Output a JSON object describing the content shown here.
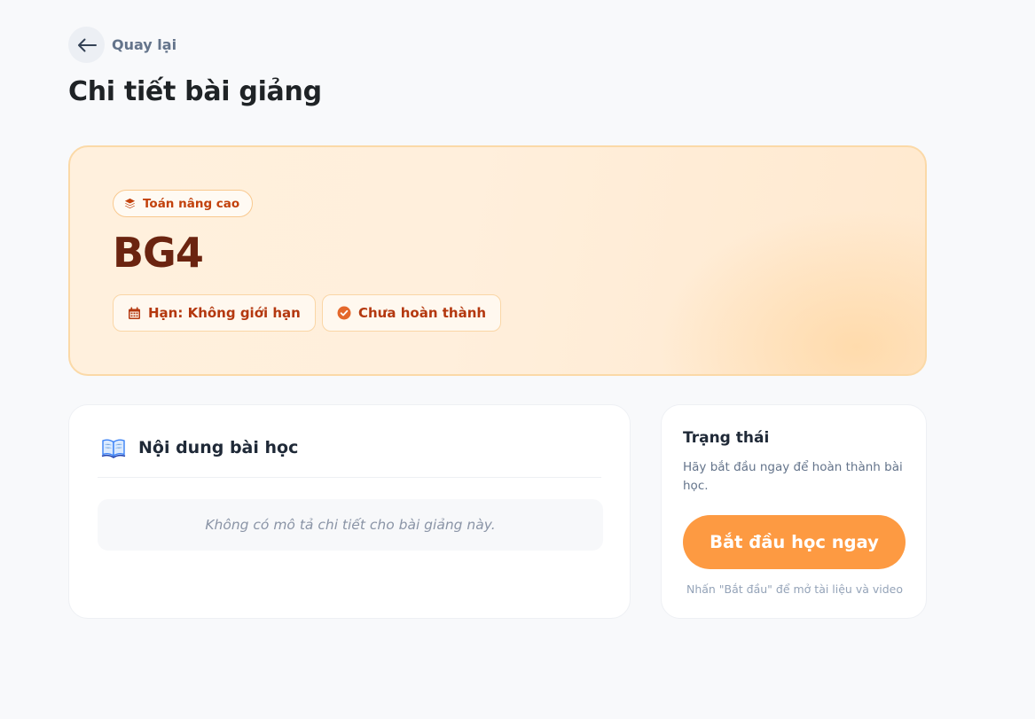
{
  "nav": {
    "back_label": "Quay lại"
  },
  "page": {
    "title": "Chi tiết bài giảng"
  },
  "lecture": {
    "category": "Toán nâng cao",
    "code": "BG4",
    "deadline": "Hạn: Không giới hạn",
    "status": "Chưa hoàn thành"
  },
  "content": {
    "title": "Nội dung bài học",
    "empty_message": "Không có mô tả chi tiết cho bài giảng này."
  },
  "status_panel": {
    "title": "Trạng thái",
    "description": "Hãy bắt đầu ngay để hoàn thành bài học.",
    "button_label": "Bắt đầu học ngay",
    "hint": "Nhấn \"Bắt đầu\" để mở tài liệu và video"
  },
  "icons": {
    "back": "arrow-left-icon",
    "category": "layers-icon",
    "deadline": "calendar-icon",
    "status": "check-circle-icon",
    "content": "open-book-icon"
  },
  "colors": {
    "accent": "#fd9a42",
    "hero_text": "#6b2410",
    "chip_text": "#b4380f",
    "category_text": "#c2410c"
  }
}
